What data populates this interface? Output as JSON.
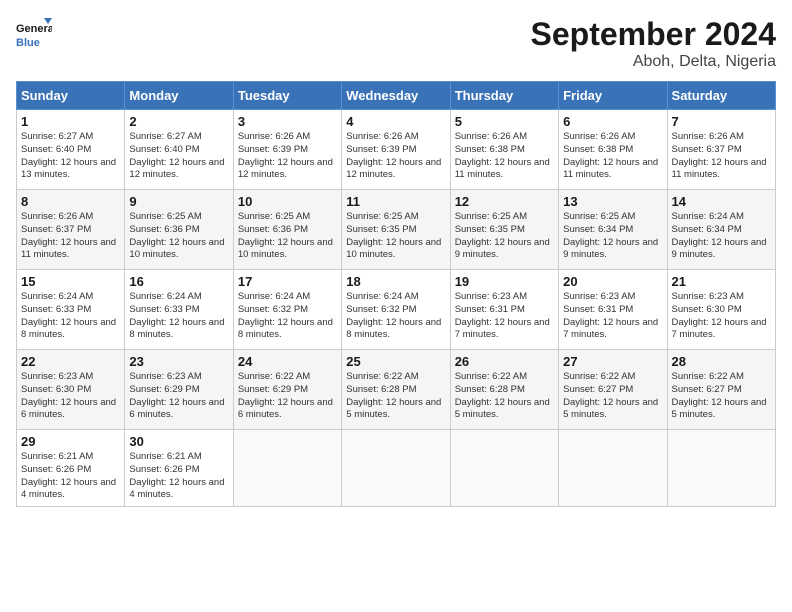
{
  "logo": {
    "line1": "General",
    "line2": "Blue"
  },
  "title": "September 2024",
  "location": "Aboh, Delta, Nigeria",
  "days_header": [
    "Sunday",
    "Monday",
    "Tuesday",
    "Wednesday",
    "Thursday",
    "Friday",
    "Saturday"
  ],
  "weeks": [
    [
      {
        "day": "1",
        "sunrise": "6:27 AM",
        "sunset": "6:40 PM",
        "daylight": "12 hours and 13 minutes."
      },
      {
        "day": "2",
        "sunrise": "6:27 AM",
        "sunset": "6:40 PM",
        "daylight": "12 hours and 12 minutes."
      },
      {
        "day": "3",
        "sunrise": "6:26 AM",
        "sunset": "6:39 PM",
        "daylight": "12 hours and 12 minutes."
      },
      {
        "day": "4",
        "sunrise": "6:26 AM",
        "sunset": "6:39 PM",
        "daylight": "12 hours and 12 minutes."
      },
      {
        "day": "5",
        "sunrise": "6:26 AM",
        "sunset": "6:38 PM",
        "daylight": "12 hours and 11 minutes."
      },
      {
        "day": "6",
        "sunrise": "6:26 AM",
        "sunset": "6:38 PM",
        "daylight": "12 hours and 11 minutes."
      },
      {
        "day": "7",
        "sunrise": "6:26 AM",
        "sunset": "6:37 PM",
        "daylight": "12 hours and 11 minutes."
      }
    ],
    [
      {
        "day": "8",
        "sunrise": "6:26 AM",
        "sunset": "6:37 PM",
        "daylight": "12 hours and 11 minutes."
      },
      {
        "day": "9",
        "sunrise": "6:25 AM",
        "sunset": "6:36 PM",
        "daylight": "12 hours and 10 minutes."
      },
      {
        "day": "10",
        "sunrise": "6:25 AM",
        "sunset": "6:36 PM",
        "daylight": "12 hours and 10 minutes."
      },
      {
        "day": "11",
        "sunrise": "6:25 AM",
        "sunset": "6:35 PM",
        "daylight": "12 hours and 10 minutes."
      },
      {
        "day": "12",
        "sunrise": "6:25 AM",
        "sunset": "6:35 PM",
        "daylight": "12 hours and 9 minutes."
      },
      {
        "day": "13",
        "sunrise": "6:25 AM",
        "sunset": "6:34 PM",
        "daylight": "12 hours and 9 minutes."
      },
      {
        "day": "14",
        "sunrise": "6:24 AM",
        "sunset": "6:34 PM",
        "daylight": "12 hours and 9 minutes."
      }
    ],
    [
      {
        "day": "15",
        "sunrise": "6:24 AM",
        "sunset": "6:33 PM",
        "daylight": "12 hours and 8 minutes."
      },
      {
        "day": "16",
        "sunrise": "6:24 AM",
        "sunset": "6:33 PM",
        "daylight": "12 hours and 8 minutes."
      },
      {
        "day": "17",
        "sunrise": "6:24 AM",
        "sunset": "6:32 PM",
        "daylight": "12 hours and 8 minutes."
      },
      {
        "day": "18",
        "sunrise": "6:24 AM",
        "sunset": "6:32 PM",
        "daylight": "12 hours and 8 minutes."
      },
      {
        "day": "19",
        "sunrise": "6:23 AM",
        "sunset": "6:31 PM",
        "daylight": "12 hours and 7 minutes."
      },
      {
        "day": "20",
        "sunrise": "6:23 AM",
        "sunset": "6:31 PM",
        "daylight": "12 hours and 7 minutes."
      },
      {
        "day": "21",
        "sunrise": "6:23 AM",
        "sunset": "6:30 PM",
        "daylight": "12 hours and 7 minutes."
      }
    ],
    [
      {
        "day": "22",
        "sunrise": "6:23 AM",
        "sunset": "6:30 PM",
        "daylight": "12 hours and 6 minutes."
      },
      {
        "day": "23",
        "sunrise": "6:23 AM",
        "sunset": "6:29 PM",
        "daylight": "12 hours and 6 minutes."
      },
      {
        "day": "24",
        "sunrise": "6:22 AM",
        "sunset": "6:29 PM",
        "daylight": "12 hours and 6 minutes."
      },
      {
        "day": "25",
        "sunrise": "6:22 AM",
        "sunset": "6:28 PM",
        "daylight": "12 hours and 5 minutes."
      },
      {
        "day": "26",
        "sunrise": "6:22 AM",
        "sunset": "6:28 PM",
        "daylight": "12 hours and 5 minutes."
      },
      {
        "day": "27",
        "sunrise": "6:22 AM",
        "sunset": "6:27 PM",
        "daylight": "12 hours and 5 minutes."
      },
      {
        "day": "28",
        "sunrise": "6:22 AM",
        "sunset": "6:27 PM",
        "daylight": "12 hours and 5 minutes."
      }
    ],
    [
      {
        "day": "29",
        "sunrise": "6:21 AM",
        "sunset": "6:26 PM",
        "daylight": "12 hours and 4 minutes."
      },
      {
        "day": "30",
        "sunrise": "6:21 AM",
        "sunset": "6:26 PM",
        "daylight": "12 hours and 4 minutes."
      },
      null,
      null,
      null,
      null,
      null
    ]
  ]
}
